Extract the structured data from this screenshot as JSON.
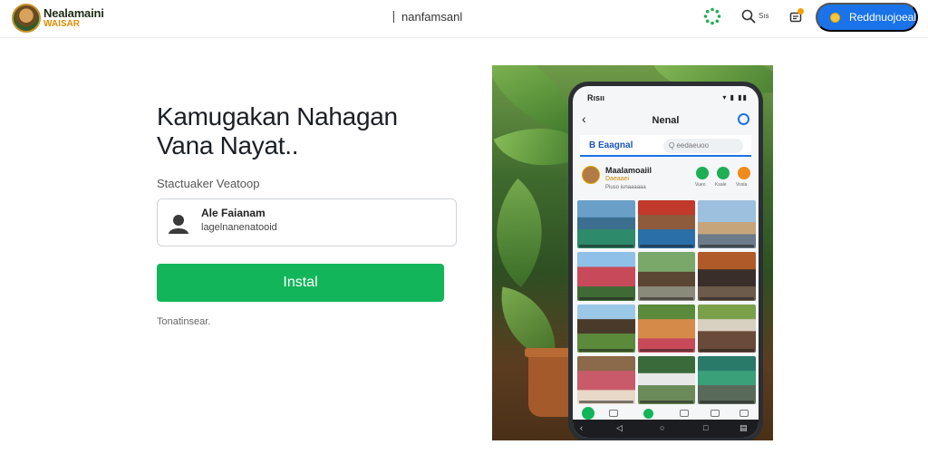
{
  "header": {
    "brand_line1": "Nealamaini",
    "brand_line2": "WAISAR",
    "center_link": "nanfamsanl",
    "search_label": "Sıs",
    "cta_label": "Reddnuojoeal",
    "icons": [
      "loader-icon",
      "search-icon",
      "gift-icon",
      "coin-icon"
    ]
  },
  "main": {
    "headline_line1": "Kamugakan Nahagan",
    "headline_line2": "Vana Nayat..",
    "subtitle": "Stactuaker Veatoop",
    "account": {
      "name": "Ale Faianam",
      "subtitle": "lagelnanenatooid"
    },
    "install_label": "Instal",
    "footnote": "Tonatinsear."
  },
  "phone": {
    "status_time": "Rısıı",
    "status_icons": "▾ ▮ ▮▮",
    "title": "Nenal",
    "tab_active": "B Eaagnal",
    "tab_search": "Q eedaeuoo",
    "profile_name": "Maalamoaiil",
    "profile_sub": "Daeaaei",
    "profile_sub2": "Piuso iunaaaaaa",
    "profile_actions": [
      {
        "label": "Vueo",
        "color": "#1fae54"
      },
      {
        "label": "Ksale",
        "color": "#1fae54"
      },
      {
        "label": "Vosla",
        "color": "#f08a1c"
      }
    ],
    "accent": "#1a73e8",
    "install_color": "#13b55a"
  }
}
